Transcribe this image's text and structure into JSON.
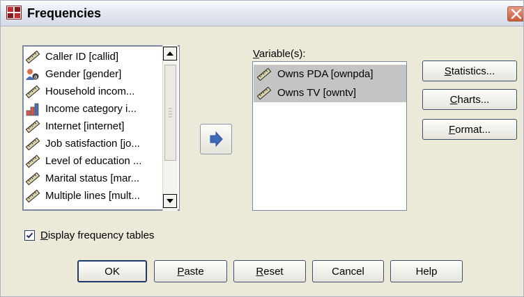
{
  "window": {
    "title": "Frequencies"
  },
  "source_list": {
    "items": [
      {
        "label": "Caller ID [callid]",
        "icon": "scale-variable-icon"
      },
      {
        "label": "Gender [gender]",
        "icon": "nominal-variable-icon"
      },
      {
        "label": "Household incom...",
        "icon": "scale-variable-icon"
      },
      {
        "label": "Income category i...",
        "icon": "ordinal-variable-icon"
      },
      {
        "label": "Internet [internet]",
        "icon": "scale-variable-icon"
      },
      {
        "label": "Job satisfaction [jo...",
        "icon": "scale-variable-icon"
      },
      {
        "label": "Level of education ...",
        "icon": "scale-variable-icon"
      },
      {
        "label": "Marital status [mar...",
        "icon": "scale-variable-icon"
      },
      {
        "label": "Multiple lines [mult...",
        "icon": "scale-variable-icon"
      }
    ]
  },
  "move_button": {
    "icon": "right-arrow-icon"
  },
  "target": {
    "label_mnemonic": "V",
    "label_rest": "ariable(s):",
    "items": [
      {
        "label": "Owns PDA [ownpda]",
        "icon": "scale-variable-icon"
      },
      {
        "label": "Owns TV [owntv]",
        "icon": "scale-variable-icon"
      }
    ]
  },
  "side_buttons": {
    "statistics": {
      "mnemonic": "S",
      "rest": "tatistics..."
    },
    "charts": {
      "mnemonic": "C",
      "rest": "harts..."
    },
    "format": {
      "mnemonic": "F",
      "rest": "ormat..."
    }
  },
  "display_tables": {
    "mnemonic": "D",
    "rest": "isplay frequency tables",
    "checked": true
  },
  "buttons": {
    "ok": "OK",
    "paste": {
      "mnemonic": "P",
      "rest": "aste"
    },
    "reset": {
      "mnemonic": "R",
      "rest": "eset"
    },
    "cancel": "Cancel",
    "help": "Help"
  },
  "colors": {
    "selection": "#c4c4c4",
    "dialog_bg": "#ece9d8",
    "list_border": "#7a8aa3"
  }
}
